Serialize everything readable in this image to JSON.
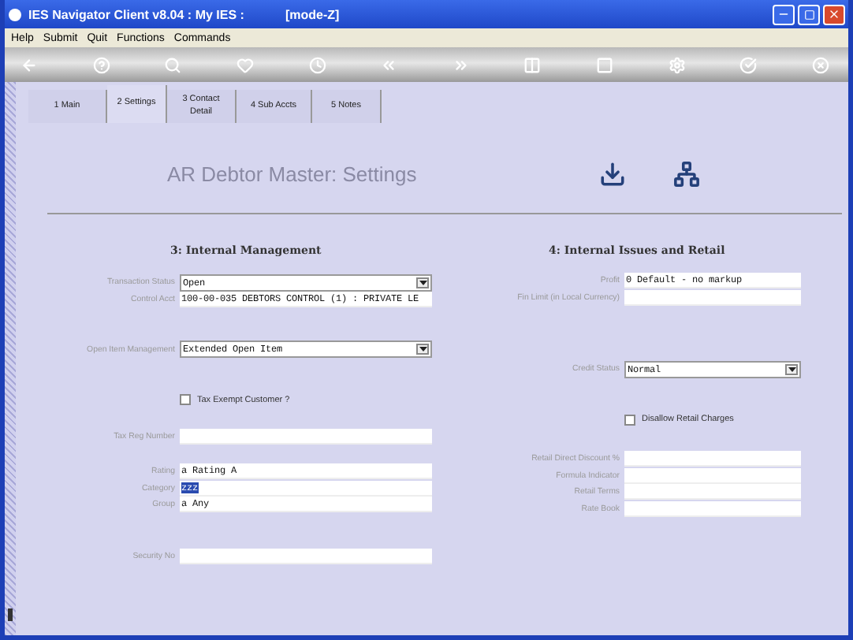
{
  "window": {
    "title": "IES Navigator Client v8.04 : My IES :",
    "mode": "[mode-Z]"
  },
  "menu": [
    "Help",
    "Submit",
    "Quit",
    "Functions",
    "Commands"
  ],
  "tabs": [
    {
      "label": "1 Main",
      "selected": false
    },
    {
      "label": "2 Settings",
      "selected": true
    },
    {
      "label": "3 Contact Detail",
      "selected": false
    },
    {
      "label": "4 Sub Accts",
      "selected": false
    },
    {
      "label": "5 Notes",
      "selected": false
    }
  ],
  "heading": "AR Debtor Master: Settings",
  "sections": [
    {
      "title": "3: Internal Management",
      "groups": [
        [
          {
            "kind": "select",
            "label": "Transaction Status",
            "value": "Open"
          },
          {
            "kind": "text",
            "label": "Control Acct",
            "value": "100-00-035 DEBTORS CONTROL (1) : PRIVATE LE",
            "highlighted": false
          }
        ],
        [
          {
            "kind": "select",
            "label": "Open Item Management",
            "value": "Extended Open Item"
          }
        ],
        [
          {
            "kind": "checkbox",
            "label": "Tax Exempt Customer ?",
            "checked": false
          }
        ],
        [
          {
            "kind": "text",
            "label": "Tax Reg Number"
          }
        ],
        [
          {
            "kind": "text",
            "label": "Rating",
            "value": "a Rating A",
            "highlighted": false
          },
          {
            "kind": "text",
            "label": "Category",
            "value": "zzz",
            "highlighted": true
          },
          {
            "kind": "text",
            "label": "Group",
            "value": "a Any",
            "highlighted": false
          }
        ],
        [
          {
            "kind": "text",
            "label": "Security No"
          }
        ]
      ]
    },
    {
      "title": "4: Internal Issues and Retail",
      "groups": [
        [
          {
            "kind": "text",
            "label": "Profit",
            "value": "0 Default - no markup",
            "highlighted": false
          },
          {
            "kind": "text",
            "label": "Fin Limit (in Local Currency)"
          }
        ],
        [
          {
            "kind": "select",
            "label": "Credit Status",
            "value": "Normal"
          }
        ],
        [
          {
            "kind": "checkbox",
            "label": "Disallow Retail Charges",
            "checked": false
          }
        ],
        [
          {
            "kind": "text",
            "label": "Retail Direct Discount %"
          },
          {
            "kind": "text",
            "label": "Formula Indicator"
          },
          {
            "kind": "text",
            "label": "Retail Terms"
          },
          {
            "kind": "text",
            "label": "Rate Book"
          }
        ]
      ]
    }
  ]
}
